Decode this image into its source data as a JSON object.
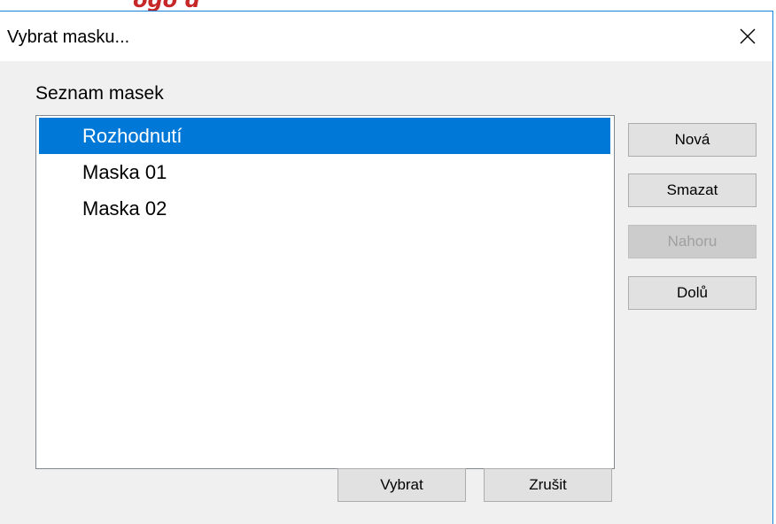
{
  "window": {
    "title": "Vybrat masku...",
    "close_icon": "close-icon"
  },
  "group": {
    "label": "Seznam masek"
  },
  "list": {
    "items": [
      {
        "label": "Rozhodnutí",
        "selected": true
      },
      {
        "label": "Maska 01",
        "selected": false
      },
      {
        "label": "Maska 02",
        "selected": false
      }
    ]
  },
  "side_buttons": {
    "new": {
      "label": "Nová",
      "enabled": true
    },
    "delete": {
      "label": "Smazat",
      "enabled": true
    },
    "up": {
      "label": "Nahoru",
      "enabled": false
    },
    "down": {
      "label": "Dolů",
      "enabled": true
    }
  },
  "footer_buttons": {
    "select": {
      "label": "Vybrat"
    },
    "cancel": {
      "label": "Zrušit"
    }
  },
  "colors": {
    "selection": "#0078d7",
    "window_border": "#1883d7",
    "dialog_background": "#f0f0f0"
  }
}
